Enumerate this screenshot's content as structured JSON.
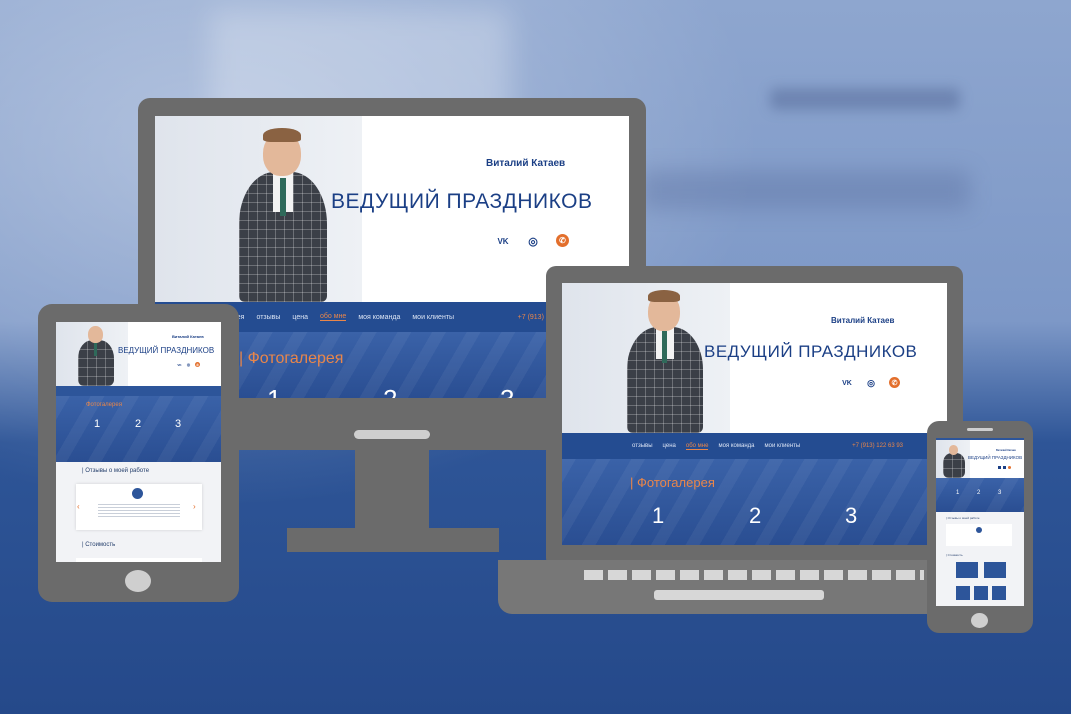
{
  "site": {
    "name": "Виталий Катаев",
    "title": "ВЕДУЩИЙ ПРАЗДНИКОВ",
    "social": {
      "vk": "VK",
      "instagram": "◎",
      "whatsapp": "✆"
    },
    "nav": {
      "gallery_short": "ерея",
      "reviews": "отзывы",
      "price": "цена",
      "about": "обо мне",
      "team": "моя команда",
      "clients": "мои клиенты",
      "phone": "+7 (913) 122 63 93"
    },
    "gallery_title": "| Фотогалерея",
    "gallery_numbers": [
      "1",
      "2",
      "3"
    ],
    "tablet_gallery_title": "Фотогалерея",
    "reviews_title": "| Отзывы о моей работе",
    "price_title": "| Стоимость"
  },
  "colors": {
    "brand_blue": "#1b3f85",
    "nav_blue": "#244c91",
    "accent_orange": "#e9864a",
    "device_gray": "#6b6b6b"
  }
}
